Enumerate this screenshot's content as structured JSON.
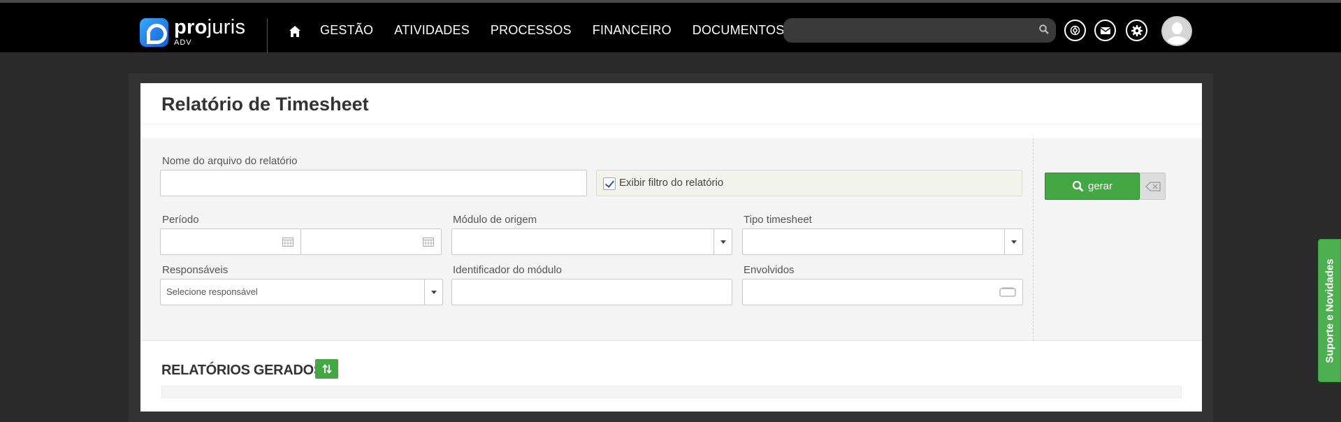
{
  "app": {
    "name_bold": "pro",
    "name_light": "juris",
    "edition": "ADV"
  },
  "nav": {
    "items": [
      "GESTÃO",
      "ATIVIDADES",
      "PROCESSOS",
      "FINANCEIRO",
      "DOCUMENTOS"
    ]
  },
  "search": {
    "value": "",
    "placeholder": ""
  },
  "page": {
    "title": "Relatório de Timesheet"
  },
  "form": {
    "file_name_label": "Nome do arquivo do relatório",
    "file_name_value": "",
    "show_filter_label": "Exibir filtro do relatório",
    "show_filter_checked": true,
    "period_label": "Período",
    "period_start": "",
    "period_end": "",
    "module_label": "Módulo de origem",
    "module_value": "",
    "type_label": "Tipo timesheet",
    "type_value": "",
    "responsible_label": "Responsáveis",
    "responsible_placeholder": "Selecione responsável",
    "module_id_label": "Identificador do módulo",
    "module_id_value": "",
    "involved_label": "Envolvidos",
    "involved_value": ""
  },
  "actions": {
    "generate_label": "gerar"
  },
  "reports": {
    "title": "RELATÓRIOS GERADOS"
  },
  "support": {
    "label": "Suporte e Novidades"
  },
  "colors": {
    "topbar": "#000000",
    "accent_green": "#43a843",
    "page_bg": "#2b2b2b"
  }
}
